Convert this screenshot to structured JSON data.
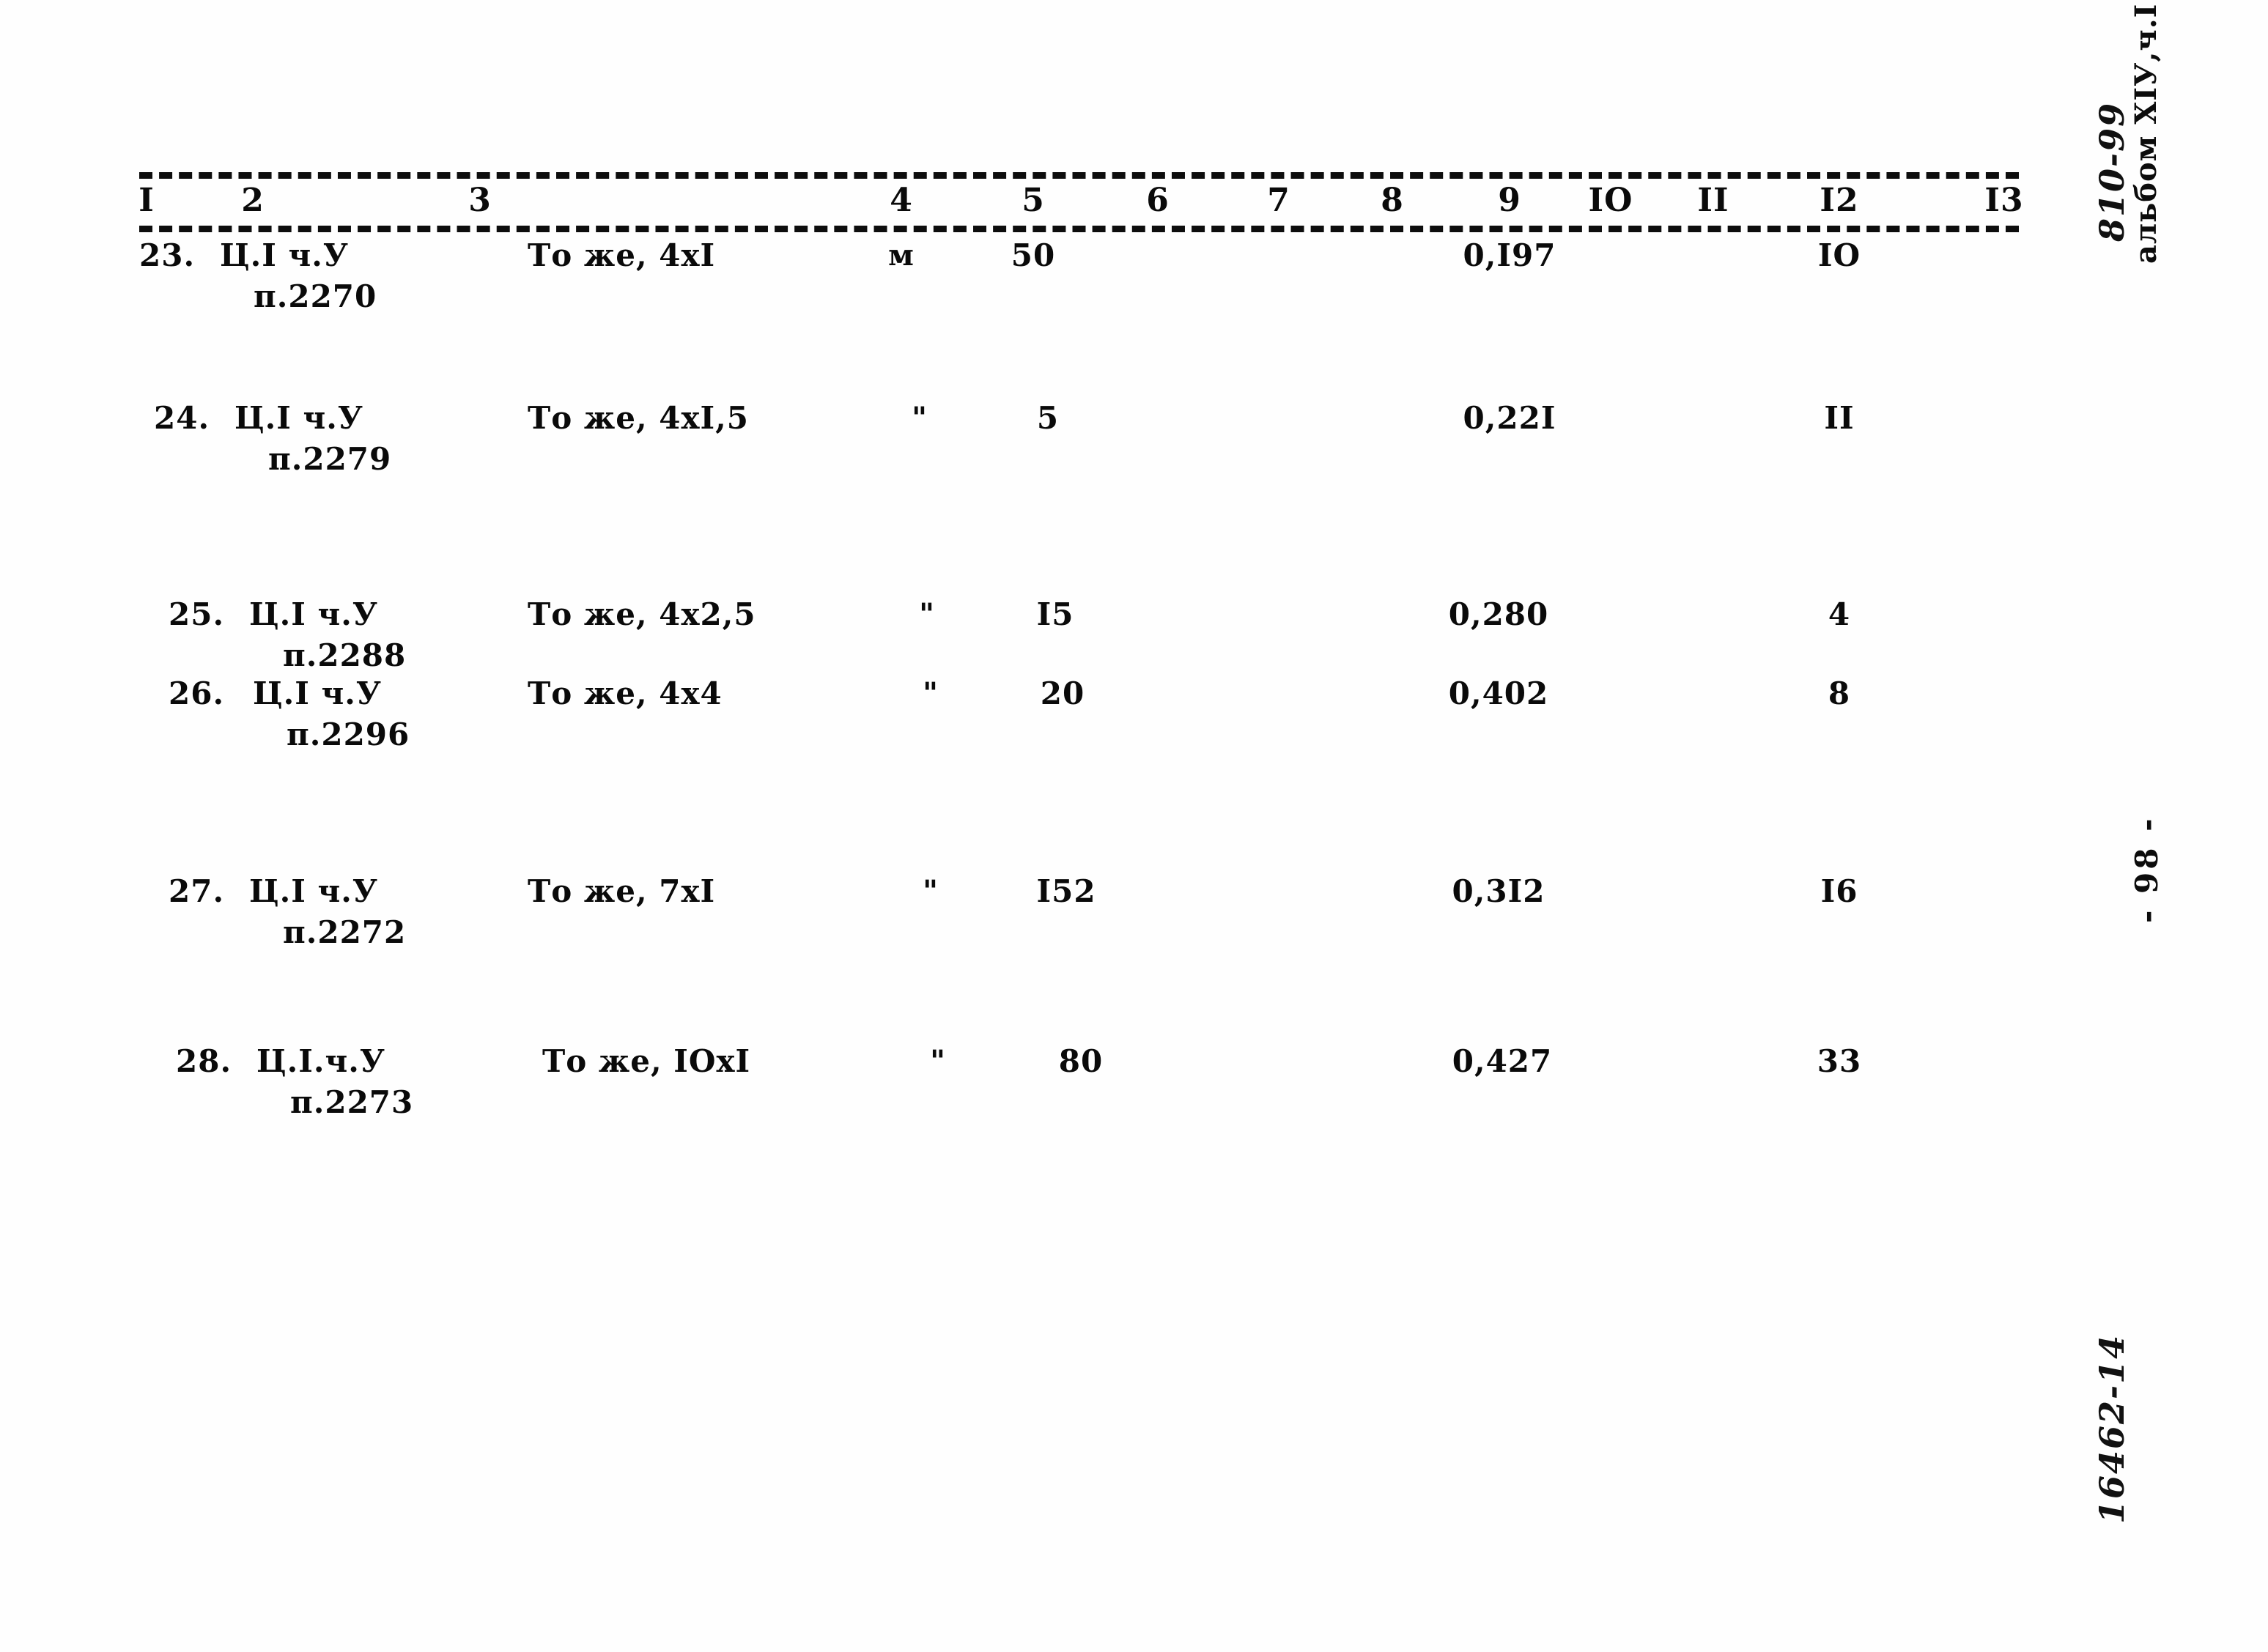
{
  "table": {
    "column_headers": [
      "I",
      "2",
      "3",
      "4",
      "5",
      "6",
      "7",
      "8",
      "9",
      "IO",
      "II",
      "I2",
      "I3"
    ],
    "rows": [
      {
        "num": "23.",
        "code_line1": "Ц.I ч.У",
        "code_line2": "п.2270",
        "description": "То же, 4xI",
        "unit": "м",
        "qty": "50",
        "col6": "",
        "col7": "",
        "col8": "",
        "mass": "0,I97",
        "col10": "",
        "col11": "",
        "col12": "IO",
        "col13": ""
      },
      {
        "num": "24.",
        "code_line1": "Ц.I ч.У",
        "code_line2": "п.2279",
        "description": "То же, 4xI,5",
        "unit": "\"",
        "qty": "5",
        "col6": "",
        "col7": "",
        "col8": "",
        "mass": "0,22I",
        "col10": "",
        "col11": "",
        "col12": "II",
        "col13": ""
      },
      {
        "num": "25.",
        "code_line1": "Ц.I ч.У",
        "code_line2": "п.2288",
        "description": "То же, 4x2,5",
        "unit": "\"",
        "qty": "I5",
        "col6": "",
        "col7": "",
        "col8": "",
        "mass": "0,280",
        "col10": "",
        "col11": "",
        "col12": "4",
        "col13": ""
      },
      {
        "num": "26.",
        "code_line1": "Ц.I ч.У",
        "code_line2": "п.2296",
        "description": "То же, 4x4",
        "unit": "\"",
        "qty": "20",
        "col6": "",
        "col7": "",
        "col8": "",
        "mass": "0,402",
        "col10": "",
        "col11": "",
        "col12": "8",
        "col13": ""
      },
      {
        "num": "27.",
        "code_line1": "Ц.I ч.У",
        "code_line2": "п.2272",
        "description": "То же, 7xI",
        "unit": "\"",
        "qty": "I52",
        "col6": "",
        "col7": "",
        "col8": "",
        "mass": "0,3I2",
        "col10": "",
        "col11": "",
        "col12": "I6",
        "col13": ""
      },
      {
        "num": "28.",
        "code_line1": "Ц.I.ч.У",
        "code_line2": "п.2273",
        "description": "То же, IOxI",
        "unit": "\"",
        "qty": "80",
        "col6": "",
        "col7": "",
        "col8": "",
        "mass": "0,427",
        "col10": "",
        "col11": "",
        "col12": "33",
        "col13": ""
      }
    ]
  },
  "margins": {
    "album_note": "альбом XIУ,ч.I",
    "album_code": "810-99",
    "page_number": "- 98 -",
    "archive_code": "16462-14"
  }
}
